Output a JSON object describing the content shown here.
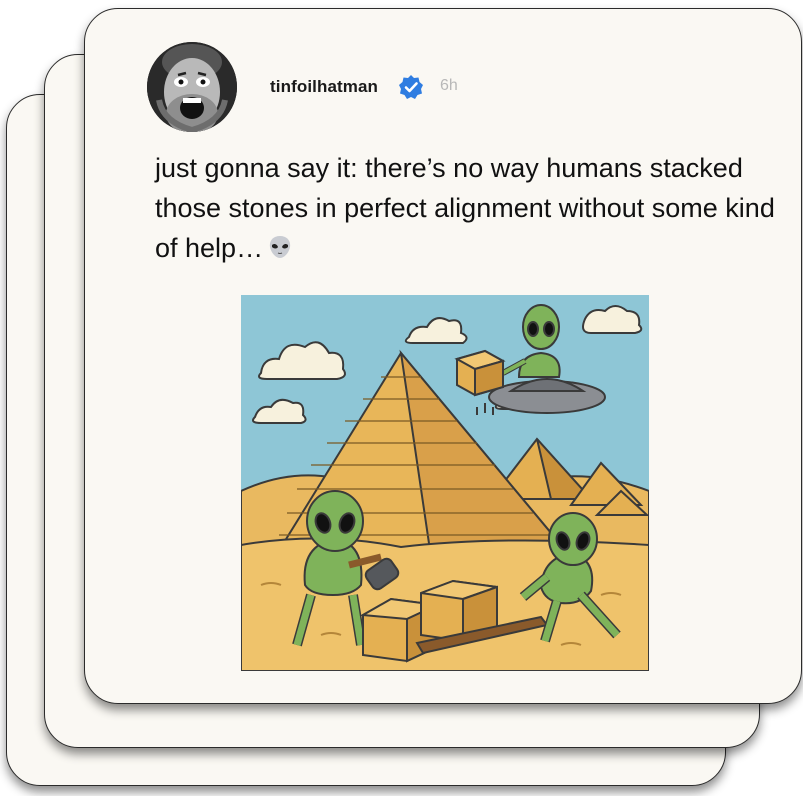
{
  "post": {
    "username": "tinfoilhatman",
    "verified": true,
    "timestamp": "6h",
    "text": "just gonna say it: there’s no way humans stacked those stones in perfect alignment without some kind of help…",
    "emoji": "alien-face-icon",
    "avatar": "avatar-photo",
    "image": "illustration-aliens-building-pyramids"
  },
  "colors": {
    "card_bg": "#faf8f3",
    "verified_blue": "#2f7de1",
    "text": "#111111",
    "timestamp": "#b8b8b8",
    "sky": "#8ec6d6",
    "sand": "#e9b960",
    "alien_green": "#7fb35a"
  }
}
